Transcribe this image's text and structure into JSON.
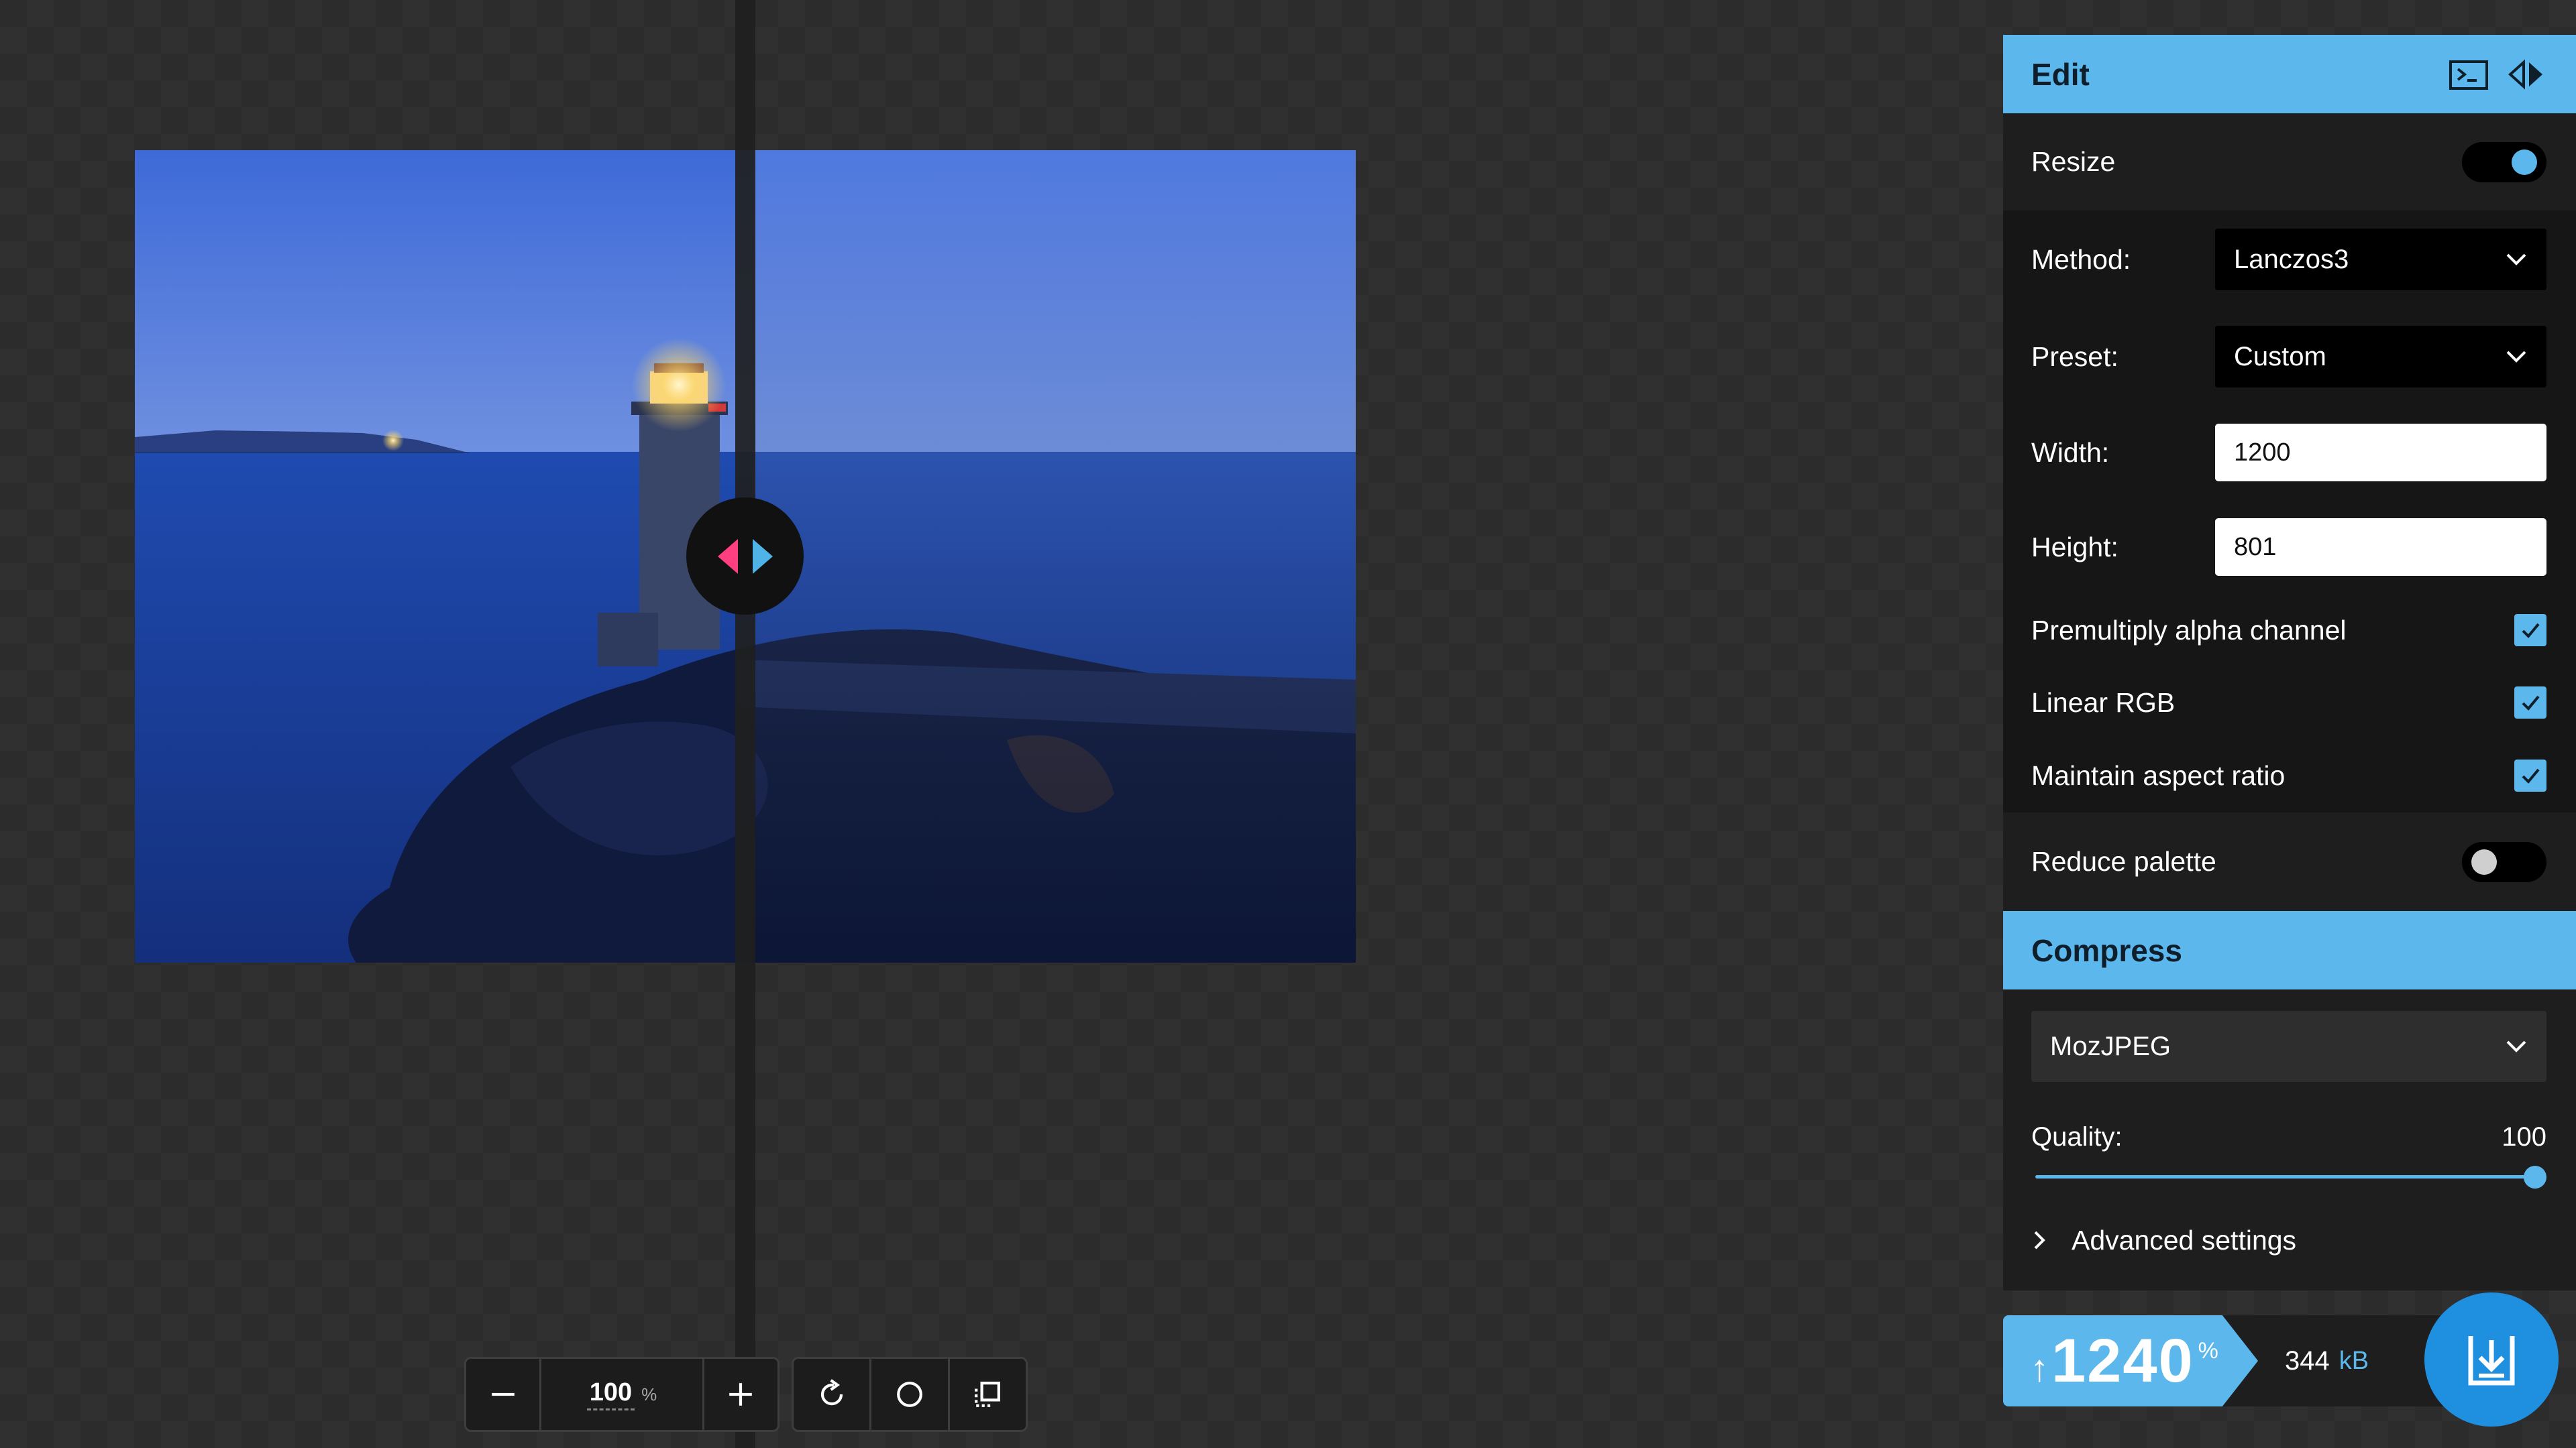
{
  "edit_panel": {
    "title": "Edit",
    "resize": {
      "label": "Resize",
      "enabled": true
    },
    "method": {
      "label": "Method:",
      "value": "Lanczos3"
    },
    "preset": {
      "label": "Preset:",
      "value": "Custom"
    },
    "width": {
      "label": "Width:",
      "value": "1200"
    },
    "height": {
      "label": "Height:",
      "value": "801"
    },
    "premultiply": {
      "label": "Premultiply alpha channel",
      "checked": true
    },
    "linear_rgb": {
      "label": "Linear RGB",
      "checked": true
    },
    "maintain_aspect": {
      "label": "Maintain aspect ratio",
      "checked": true
    },
    "reduce_palette": {
      "label": "Reduce palette",
      "enabled": false
    }
  },
  "compress_panel": {
    "title": "Compress",
    "codec": "MozJPEG",
    "quality_label": "Quality:",
    "quality_value": "100",
    "advanced_label": "Advanced settings"
  },
  "results": {
    "arrow": "↑",
    "percent": "1240",
    "percent_sign": "%",
    "size": "344",
    "size_unit": "kB"
  },
  "toolbar": {
    "zoom_value": "100",
    "zoom_unit": "%"
  },
  "colors": {
    "accent": "#5bb7ec",
    "left_arrow": "#ff3f7f",
    "right_arrow": "#4fb3e8",
    "download": "#1f8fe0"
  },
  "icons": {
    "zoom_out": "minus-icon",
    "zoom_in": "plus-icon",
    "rotate": "rotate-icon",
    "background": "circle-icon",
    "crop": "crop-icon",
    "terminal": "terminal-icon",
    "copy_settings": "split-arrows-icon",
    "download": "download-icon"
  }
}
